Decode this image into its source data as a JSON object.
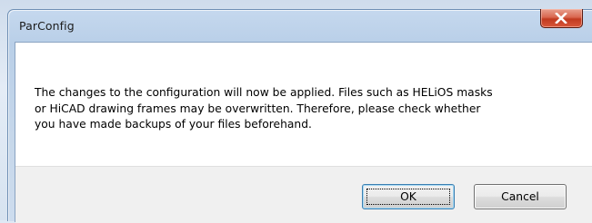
{
  "window": {
    "title": "ParConfig"
  },
  "message": {
    "line1": "The changes to the configuration will now be applied. Files such as HELiOS masks",
    "line2": "or HiCAD drawing frames may be overwritten. Therefore, please check whether",
    "line3": "you have made backups of your files beforehand."
  },
  "buttons": {
    "ok_label": "OK",
    "cancel_label": "Cancel"
  },
  "icons": {
    "close": "close-icon"
  },
  "colors": {
    "close_button": "#c13a20",
    "default_button_border": "#3c7fb1",
    "button_area": "#f0f0f0"
  }
}
